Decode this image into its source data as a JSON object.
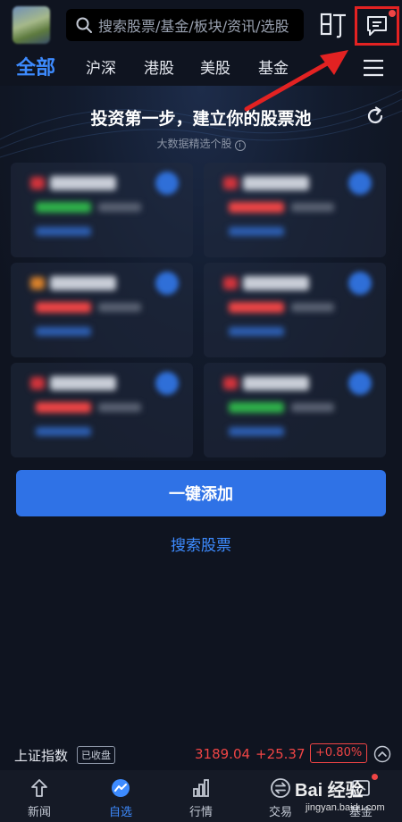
{
  "header": {
    "search_placeholder": "搜索股票/基金/板块/资讯/选股",
    "pin_icon": "pin-icon",
    "message_icon": "message-icon"
  },
  "tabs": [
    {
      "label": "全部",
      "active": true
    },
    {
      "label": "沪深"
    },
    {
      "label": "港股"
    },
    {
      "label": "美股"
    },
    {
      "label": "基金"
    }
  ],
  "pool": {
    "title": "投资第一步，建立你的股票池",
    "subtitle": "大数据精选个股",
    "info_glyph": "i",
    "cards": [
      {
        "change_color": "#2fb34a"
      },
      {
        "change_color": "#f04545"
      },
      {
        "change_color": "#f04545"
      },
      {
        "change_color": "#f04545"
      },
      {
        "change_color": "#f04545"
      },
      {
        "change_color": "#2fb34a"
      }
    ]
  },
  "actions": {
    "add_all_label": "一键添加",
    "search_stock_label": "搜索股票"
  },
  "index_ticker": {
    "name": "上证指数",
    "status": "已收盘",
    "price": "3189.04",
    "change": "+25.37",
    "change_pct": "+0.80%"
  },
  "bottom_nav": [
    {
      "label": "新闻",
      "icon": "news-icon"
    },
    {
      "label": "自选",
      "icon": "watchlist-icon",
      "active": true
    },
    {
      "label": "行情",
      "icon": "market-icon"
    },
    {
      "label": "交易",
      "icon": "trade-icon"
    },
    {
      "label": "基金",
      "icon": "fund-icon"
    }
  ],
  "watermark": {
    "main": "Bai 经验",
    "sub": "jingyan.baidu.com"
  },
  "colors": {
    "accent": "#3d8bff",
    "button": "#2f72e6",
    "up": "#f04545",
    "down": "#2fb34a",
    "annotation": "#e32222"
  }
}
